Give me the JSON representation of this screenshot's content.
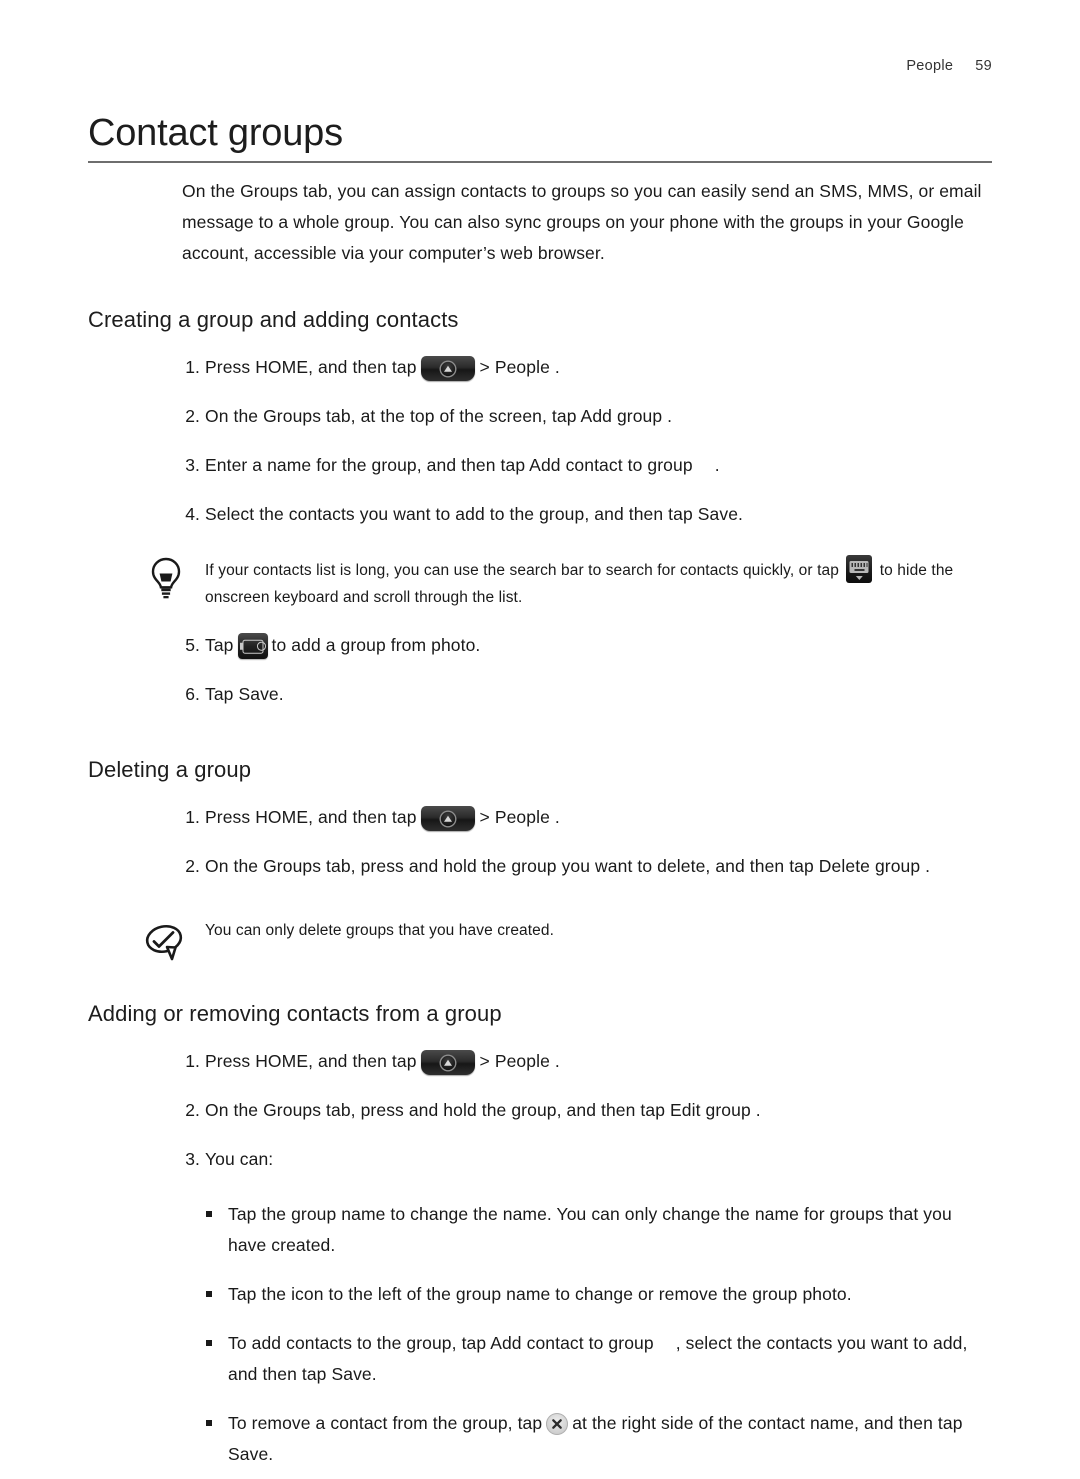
{
  "header": {
    "chapter": "People",
    "page_number": "59"
  },
  "title": "Contact groups",
  "intro": "On the Groups  tab, you can assign contacts to groups so you can easily send an SMS, MMS, or email message to a whole group. You can also sync groups on your phone with the groups in your Google account, accessible via your computer’s web browser.",
  "sections": [
    {
      "heading": "Creating a group and adding contacts",
      "steps": [
        {
          "num": "1.",
          "before": "Press HOME, and then tap",
          "icon": "home-button-icon",
          "after": "> People ."
        },
        {
          "num": "2.",
          "before": "On the Groups  tab, at the top of the screen, tap Add group   .",
          "icon": null,
          "after": ""
        },
        {
          "num": "3.",
          "before": "Enter a name for the group, and then tap Add contact to group",
          "icon": null,
          "after": "."
        },
        {
          "num": "4.",
          "before": "Select the contacts you want to add to the group, and then tap Save.",
          "icon": null,
          "after": ""
        }
      ],
      "tip": {
        "icon": "lightbulb-icon",
        "text_before": "If your contacts list is long, you can use the search bar to search for contacts quickly, or tap",
        "inline_icon": "keyboard-icon",
        "text_after": "to hide the onscreen keyboard and scroll through the list."
      },
      "steps_after_tip": [
        {
          "num": "5.",
          "before": "Tap",
          "icon": "camera-icon",
          "after": "to add a group from photo."
        },
        {
          "num": "6.",
          "before": "Tap Save.",
          "icon": null,
          "after": ""
        }
      ]
    },
    {
      "heading": "Deleting a group",
      "steps": [
        {
          "num": "1.",
          "before": "Press HOME, and then tap",
          "icon": "home-button-icon",
          "after": "> People ."
        },
        {
          "num": "2.",
          "before": "On the Groups  tab, press and hold the group you want to delete, and then tap Delete group .",
          "icon": null,
          "after": ""
        }
      ],
      "note": {
        "icon": "note-bubble-icon",
        "text": "You can only delete groups that you have created."
      }
    },
    {
      "heading": "Adding or removing contacts from a group",
      "steps": [
        {
          "num": "1.",
          "before": "Press HOME, and then tap",
          "icon": "home-button-icon",
          "after": "> People ."
        },
        {
          "num": "2.",
          "before": "On the Groups  tab, press and hold the group, and then tap Edit group  .",
          "icon": null,
          "after": ""
        },
        {
          "num": "3.",
          "before": "You can:",
          "icon": null,
          "after": ""
        }
      ],
      "bullets": [
        {
          "before": "Tap the group name to change the name. You can only change the name for groups that you have created.",
          "icon": null,
          "after": ""
        },
        {
          "before": "Tap the icon to the left of the group name to change or remove the group photo.",
          "icon": null,
          "after": ""
        },
        {
          "before": "To add contacts to the group, tap Add contact to group",
          "icon": null,
          "after": ", select the contacts you want to add, and then tap Save."
        },
        {
          "before": "To remove a contact from the group, tap",
          "icon": "close-circle-icon",
          "after": "at the right side of the contact name, and then tap Save."
        }
      ]
    }
  ]
}
